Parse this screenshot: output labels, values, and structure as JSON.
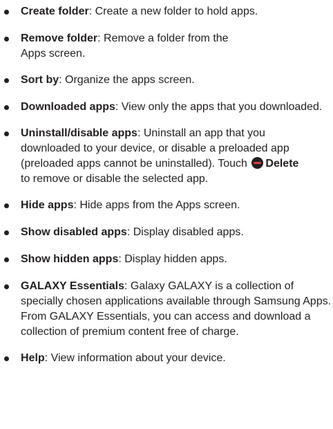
{
  "items": [
    {
      "term": "Create folder",
      "desc": ": Create a new folder to hold apps."
    },
    {
      "term": "Remove folder",
      "desc": ": Remove a folder from the Apps screen."
    },
    {
      "term": "Sort by",
      "desc": ": Organize the apps screen."
    },
    {
      "term": "Downloaded apps",
      "desc": ": View only the apps that you downloaded."
    },
    {
      "term": "Uninstall/disable apps",
      "desc_before": ": Uninstall an app that you downloaded to your device, or disable a preloaded app (preloaded apps cannot be uninstalled). Touch",
      "delete_label": "Delete",
      "desc_after": " to remove or disable the selected app."
    },
    {
      "term": "Hide apps",
      "desc": ": Hide apps from the Apps screen."
    },
    {
      "term": "Show disabled apps",
      "desc": ": Display disabled apps."
    },
    {
      "term": "Show hidden apps",
      "desc": ": Display hidden apps."
    },
    {
      "term": "GALAXY Essentials",
      "desc": ": Galaxy GALAXY is a collection of specially chosen applications available through Samsung Apps. From GALAXY Essentials, you can access and download a collection of premium content free of charge."
    },
    {
      "term": "Help",
      "desc": ": View information about your device."
    }
  ],
  "colors": {
    "text": "#231f20",
    "delete_icon_bar": "#e23b3b"
  },
  "icons": {
    "delete": "delete-icon"
  }
}
